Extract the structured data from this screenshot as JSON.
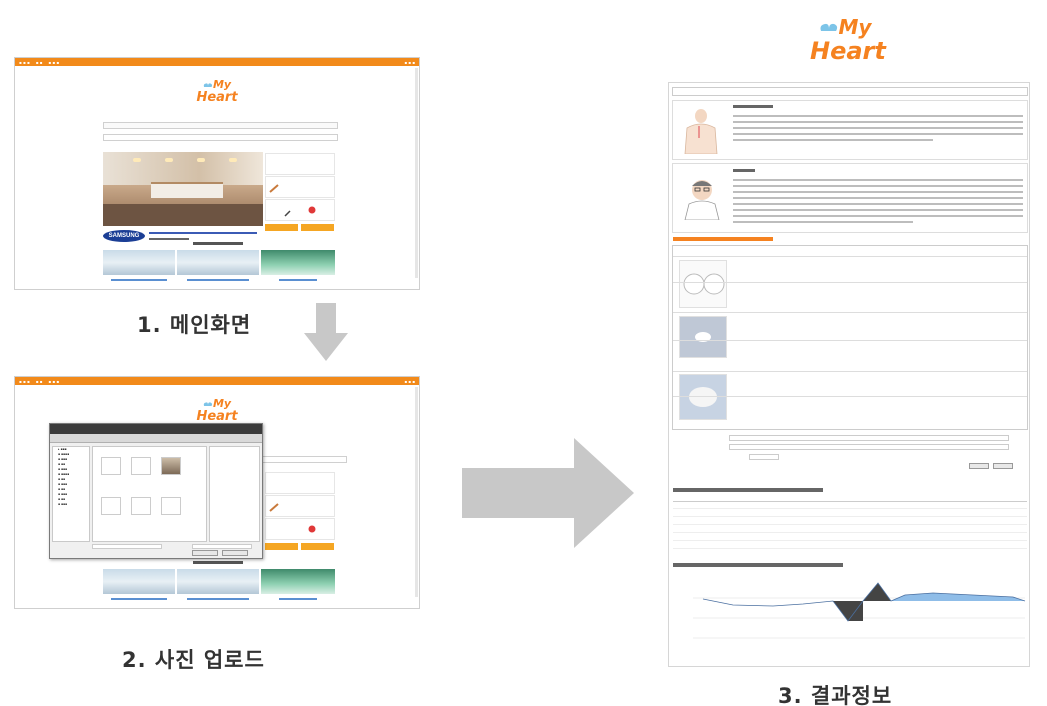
{
  "brand": {
    "my": "My",
    "heart": "Heart",
    "accent": "#f58220",
    "icon": "heart-icon"
  },
  "steps": [
    {
      "label": "1. 메인화면"
    },
    {
      "label": "2. 사진 업로드"
    },
    {
      "label": "3. 결과정보"
    }
  ],
  "colors": {
    "nav": "#f28a1a",
    "arrow": "#c8c8c8",
    "positive_area": "#6fa8dc",
    "negative_area": "#444444"
  }
}
